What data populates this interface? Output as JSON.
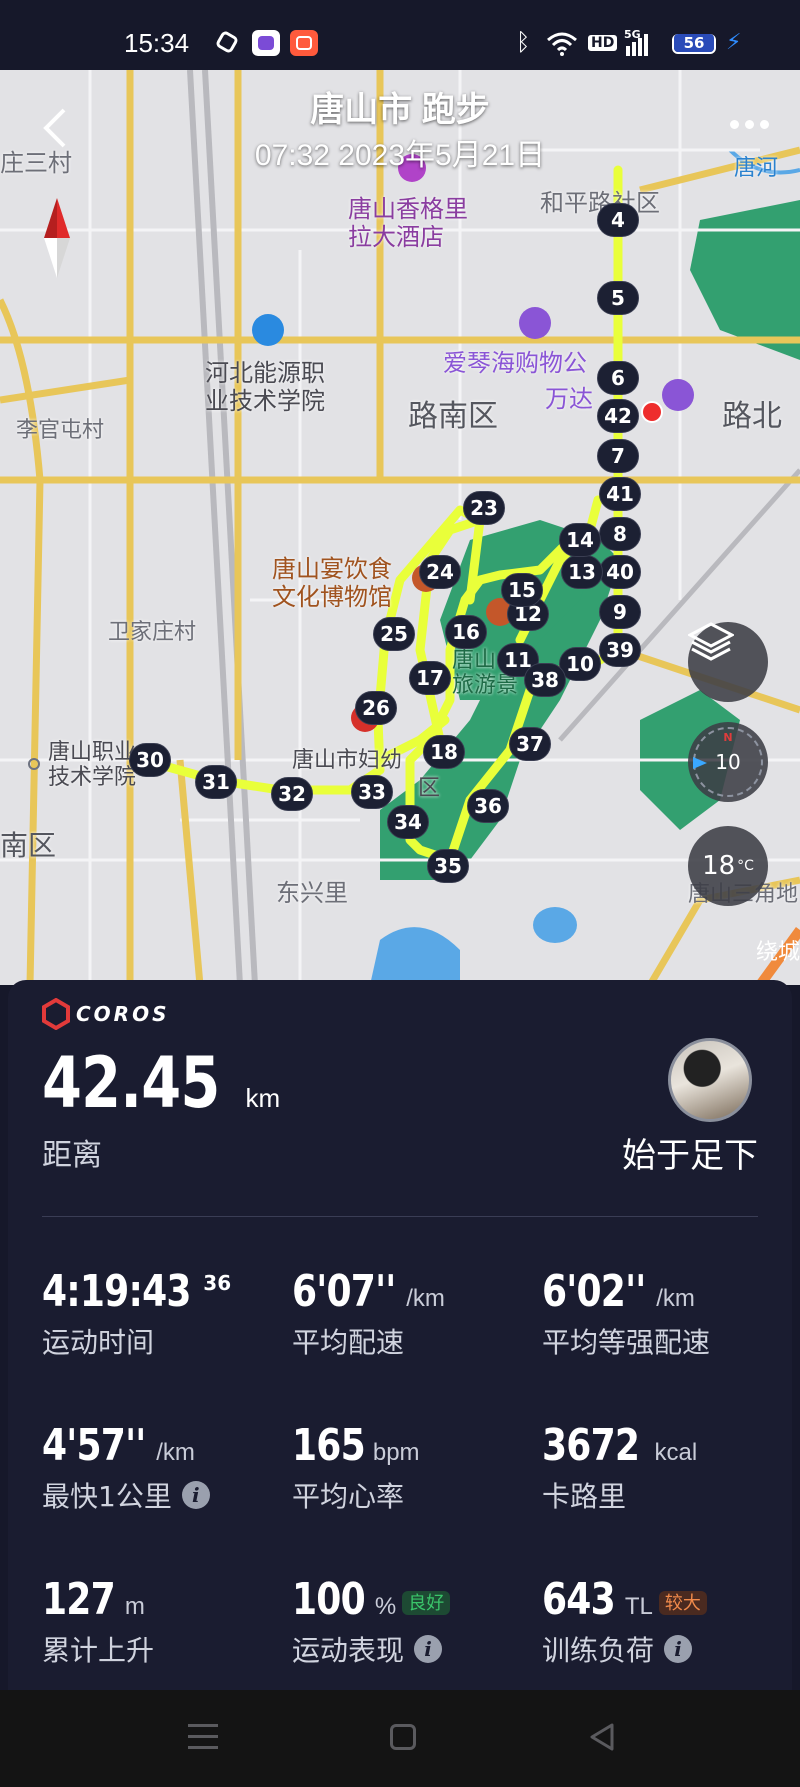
{
  "status_bar": {
    "time": "15:34",
    "battery": "56",
    "icons": [
      "notification-icon",
      "app-icon",
      "app-icon",
      "bluetooth-icon",
      "wifi-icon",
      "hd-icon",
      "5g-signal-icon",
      "battery-icon",
      "charging-icon"
    ],
    "hd_label": "HD",
    "net_label": "5G"
  },
  "map": {
    "title": "唐山市 跑步",
    "datetime": "07:32 2023年5月21日",
    "labels": {
      "hotel": "唐山香格里\n拉大酒店",
      "heping": "和平路社区",
      "zhuangsancun": "庄三村",
      "hebei_college": "河北能源职\n业技术学院",
      "aiqinhai": "爱琴海购物公",
      "wanda": "万达",
      "lunan": "路南区",
      "lubei": "路北",
      "liguantun": "李官屯村",
      "museum": "唐山宴饮食\n文化博物馆",
      "weijiazhuang": "卫家庄村",
      "tangshan_lake": "唐山\n旅游景",
      "vocational": "唐山职业\n技术学院",
      "maternal": "唐山市妇幼",
      "district_qu": "区",
      "nan_qu": "南区",
      "dongxingli": "东兴里",
      "sanjiao": "唐山三角地",
      "tanghe": "唐河",
      "raocheng": "绕城"
    },
    "km_markers": [
      "4",
      "5",
      "6",
      "42",
      "7",
      "41",
      "8",
      "40",
      "9",
      "39",
      "10",
      "11",
      "38",
      "12",
      "13",
      "14",
      "15",
      "16",
      "17",
      "18",
      "23",
      "24",
      "25",
      "26",
      "30",
      "31",
      "32",
      "33",
      "34",
      "35",
      "36",
      "37"
    ],
    "compass_value": "10",
    "compass_n": "N",
    "temperature": "18",
    "temp_unit": "°C"
  },
  "panel": {
    "brand": "COROS",
    "distance": "42.45",
    "distance_unit": "km",
    "distance_label": "距离",
    "username": "始于足下",
    "stats": [
      {
        "value": "4:19:43",
        "sup": "36",
        "unit": "",
        "label": "运动时间"
      },
      {
        "value": "6'07''",
        "unit": "/km",
        "label": "平均配速"
      },
      {
        "value": "6'02''",
        "unit": "/km",
        "label": "平均等强配速"
      },
      {
        "value": "4'57''",
        "unit": "/km",
        "label": "最快1公里"
      },
      {
        "value": "165",
        "unit": "bpm",
        "label": "平均心率"
      },
      {
        "value": "3672",
        "unit": "kcal",
        "label": "卡路里"
      },
      {
        "value": "127",
        "unit": "m",
        "label": "累计上升"
      },
      {
        "value": "100",
        "unit": "%",
        "badge": "良好",
        "label": "运动表现"
      },
      {
        "value": "643",
        "unit": "TL",
        "badge": "较大",
        "label": "训练负荷"
      }
    ],
    "badge_colors": {
      "good": "#3ac46a",
      "high": "#f08a4b"
    }
  }
}
